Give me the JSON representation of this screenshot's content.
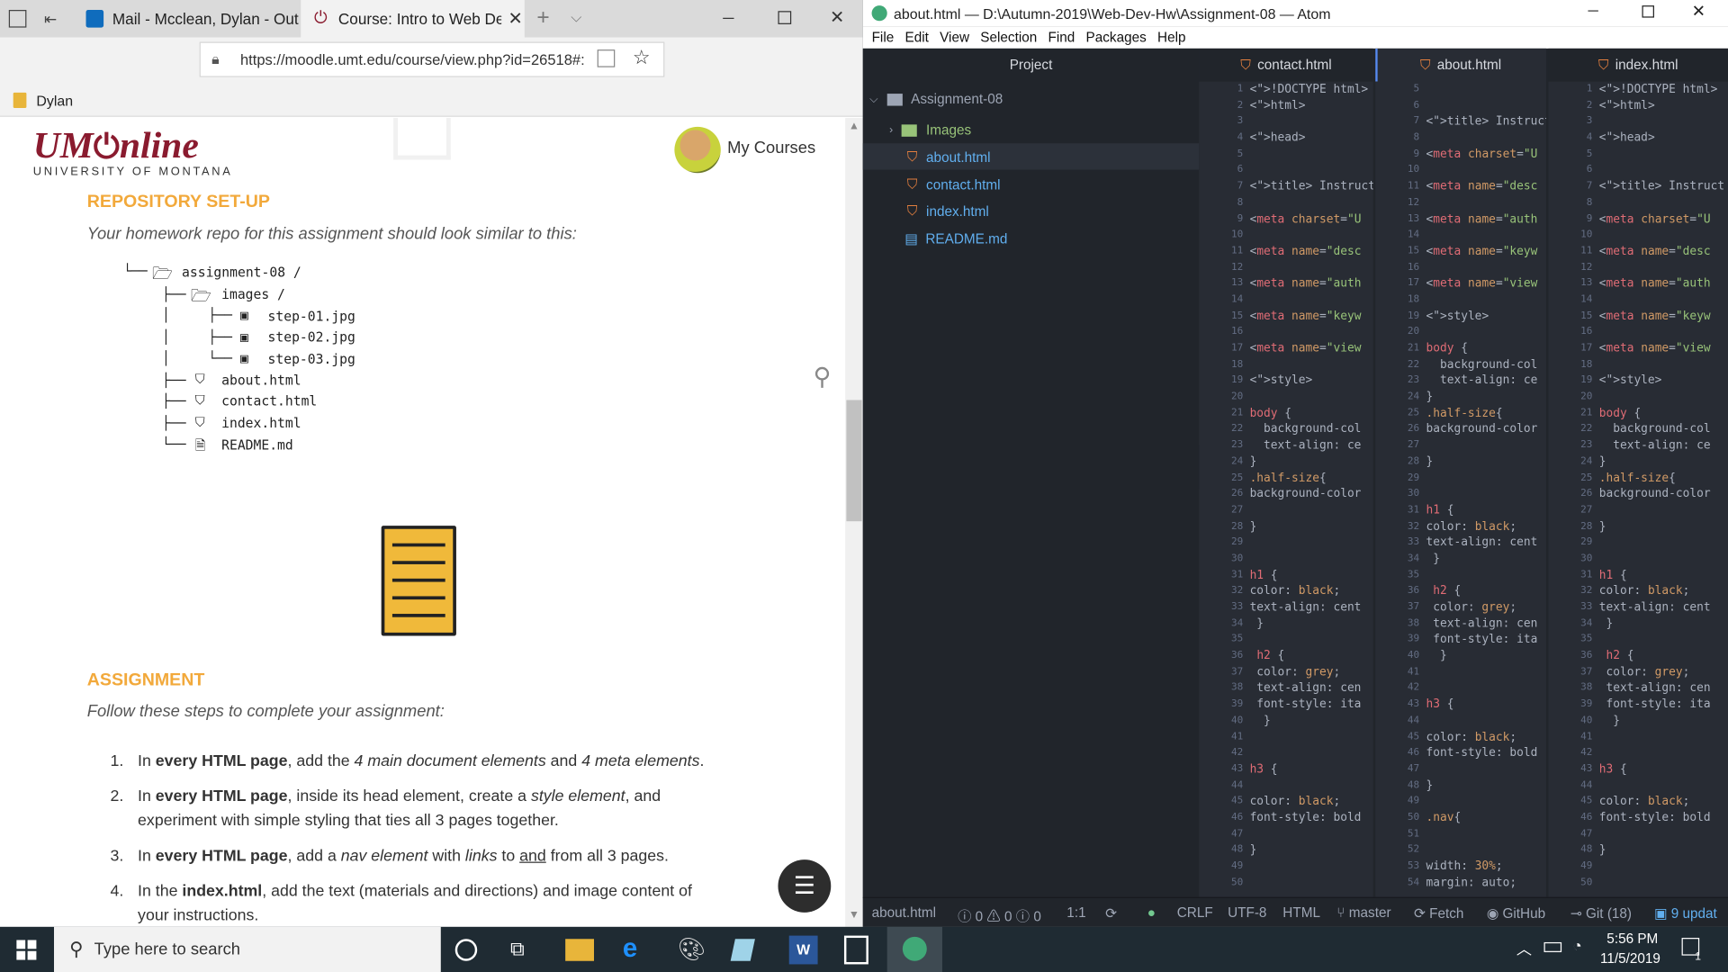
{
  "browser": {
    "tabs": [
      {
        "label": "Mail - Mcclean, Dylan - Out"
      },
      {
        "label": "Course: Intro to Web De"
      }
    ],
    "url": "https://moodle.umt.edu/course/view.php?id=26518#:",
    "favorites_folder": "Dylan"
  },
  "moodle": {
    "logo_main": "UM",
    "logo_online": "nline",
    "logo_sub": "UNIVERSITY OF MONTANA",
    "my_courses": "My Courses",
    "repo_heading": "REPOSITORY SET-UP",
    "repo_intro": "Your homework repo for this assignment should look similar to this:",
    "tree": [
      {
        "prefix": "└──",
        "name": "assignment-08 /"
      },
      {
        "prefix": "├──",
        "name": "images /"
      },
      {
        "prefix": "├──",
        "name": "step-01.jpg"
      },
      {
        "prefix": "├──",
        "name": "step-02.jpg"
      },
      {
        "prefix": "└──",
        "name": "step-03.jpg"
      },
      {
        "prefix": "├──",
        "name": "about.html"
      },
      {
        "prefix": "├──",
        "name": "contact.html"
      },
      {
        "prefix": "├──",
        "name": "index.html"
      },
      {
        "prefix": "└──",
        "name": "README.md"
      }
    ],
    "assignment_heading": "ASSIGNMENT",
    "assignment_intro": "Follow these steps to complete your assignment:",
    "steps": [
      {
        "num": "1.",
        "html": "In <b>every HTML page</b>, add the <i>4 main document elements</i> and <i>4 meta elements</i>."
      },
      {
        "num": "2.",
        "html": "In <b>every HTML page</b>, inside its head element, create a <i>style element</i>, and experiment with simple styling that ties all 3 pages together."
      },
      {
        "num": "3.",
        "html": "In <b>every HTML page</b>, add a <i>nav element</i> with <i>links</i> to <u>and</u> from all 3 pages."
      },
      {
        "num": "4.",
        "html": "In the <b>index.html</b>, add the text (materials and directions) and image content of your instructions."
      }
    ]
  },
  "atom": {
    "title": "about.html — D:\\Autumn-2019\\Web-Dev-Hw\\Assignment-08 — Atom",
    "menu": [
      "File",
      "Edit",
      "View",
      "Selection",
      "Find",
      "Packages",
      "Help"
    ],
    "project_label": "Project",
    "root_folder": "Assignment-08",
    "files": [
      "Images",
      "about.html",
      "contact.html",
      "index.html",
      "README.md"
    ],
    "panes": [
      {
        "tab": "contact.html",
        "start": 1,
        "lines": [
          "<!DOCTYPE html>",
          "<html>",
          "",
          "<head>",
          "",
          "",
          "<title> Instruct",
          "",
          "<meta charset=\"U",
          "",
          "<meta name=\"desc",
          "",
          "<meta name=\"auth",
          "",
          "<meta name=\"keyw",
          "",
          "<meta name=\"view",
          "",
          "<style>",
          "",
          "body {",
          "  background-col",
          "  text-align: ce",
          "}",
          ".half-size{",
          "background-color",
          "",
          "}",
          "",
          "",
          "h1 {",
          "color: black;",
          "text-align: cent",
          " }",
          "",
          " h2 {",
          " color: grey;",
          " text-align: cen",
          " font-style: ita",
          "  }",
          "",
          "",
          "h3 {",
          "",
          "color: black;",
          "font-style: bold",
          "",
          "}",
          "",
          ""
        ]
      },
      {
        "tab": "about.html",
        "start": 5,
        "lines": [
          "",
          "",
          "<title> Instruct",
          "",
          "<meta charset=\"U",
          "",
          "<meta name=\"desc",
          "",
          "<meta name=\"auth",
          "",
          "<meta name=\"keyw",
          "",
          "<meta name=\"view",
          "",
          "<style>",
          "",
          "body {",
          "  background-col",
          "  text-align: ce",
          "}",
          ".half-size{",
          "background-color",
          "",
          "}",
          "",
          "",
          "h1 {",
          "color: black;",
          "text-align: cent",
          " }",
          "",
          " h2 {",
          " color: grey;",
          " text-align: cen",
          " font-style: ita",
          "  }",
          "",
          "",
          "h3 {",
          "",
          "color: black;",
          "font-style: bold",
          "",
          "}",
          "",
          ".nav{",
          "",
          "",
          "width: 30%;",
          "margin: auto;"
        ]
      },
      {
        "tab": "index.html",
        "start": 1,
        "lines": [
          "<!DOCTYPE html>",
          "<html>",
          "",
          "<head>",
          "",
          "",
          "<title> Instruct",
          "",
          "<meta charset=\"U",
          "",
          "<meta name=\"desc",
          "",
          "<meta name=\"auth",
          "",
          "<meta name=\"keyw",
          "",
          "<meta name=\"view",
          "",
          "<style>",
          "",
          "body {",
          "  background-col",
          "  text-align: ce",
          "}",
          ".half-size{",
          "background-color",
          "",
          "}",
          "",
          "",
          "h1 {",
          "color: black;",
          "text-align: cent",
          " }",
          "",
          " h2 {",
          " color: grey;",
          " text-align: cen",
          " font-style: ita",
          "  }",
          "",
          "",
          "h3 {",
          "",
          "color: black;",
          "font-style: bold",
          "",
          "}",
          "",
          ""
        ]
      }
    ],
    "status": {
      "file": "about.html",
      "diagnostics": "0",
      "warnings": "0",
      "infos": "0",
      "cursor": "1:1",
      "eol": "CRLF",
      "encoding": "UTF-8",
      "grammar": "HTML",
      "branch": "master",
      "fetch": "Fetch",
      "github": "GitHub",
      "git": "Git (18)",
      "updates": "9 updat"
    }
  },
  "taskbar": {
    "search_placeholder": "Type here to search",
    "time": "5:56 PM",
    "date": "11/5/2019",
    "notifications": "1"
  }
}
